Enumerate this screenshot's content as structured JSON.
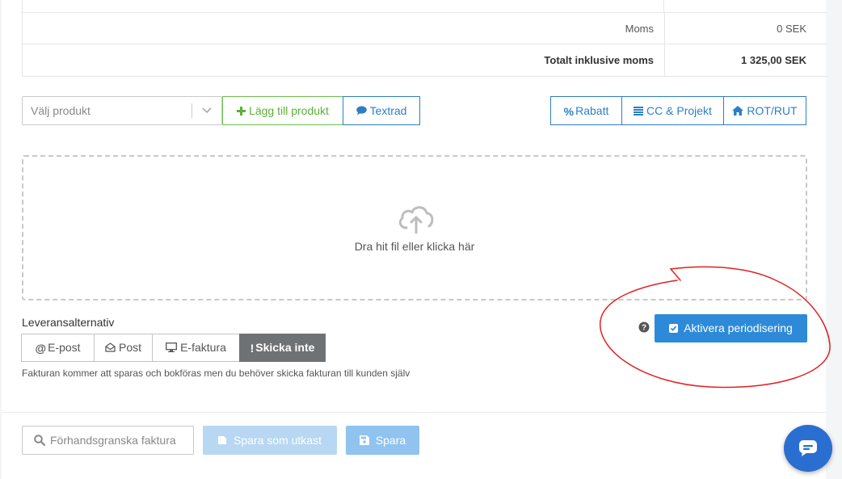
{
  "totals": {
    "vat_label": "Moms",
    "vat_value": "0 SEK",
    "total_label": "Totalt inklusive moms",
    "total_value": "1 325,00 SEK"
  },
  "products": {
    "select_placeholder": "Välj produkt",
    "add_product_label": "Lägg till produkt",
    "textrow_label": "Textrad",
    "discount_label": "Rabatt",
    "cc_project_label": "CC & Projekt",
    "rot_rut_label": "ROT/RUT"
  },
  "dropzone": {
    "text": "Dra hit fil eller klicka här"
  },
  "delivery": {
    "title": "Leveransalternativ",
    "options": [
      "E-post",
      "Post",
      "E-faktura",
      "Skicka inte"
    ],
    "selected": "Skicka inte",
    "hint": "Fakturan kommer att sparas och bokföras men du behöver skicka fakturan till kunden själv"
  },
  "periodization": {
    "button_label": "Aktivera periodisering"
  },
  "footer": {
    "preview_placeholder": "Förhandsgranska faktura",
    "save_draft_label": "Spara som utkast",
    "save_label": "Spara"
  },
  "colors": {
    "primary": "#2d7ec6",
    "success": "#5ab136",
    "active_tab": "#6f7275",
    "annotation": "#e02020",
    "chat": "#2a6ed1"
  }
}
